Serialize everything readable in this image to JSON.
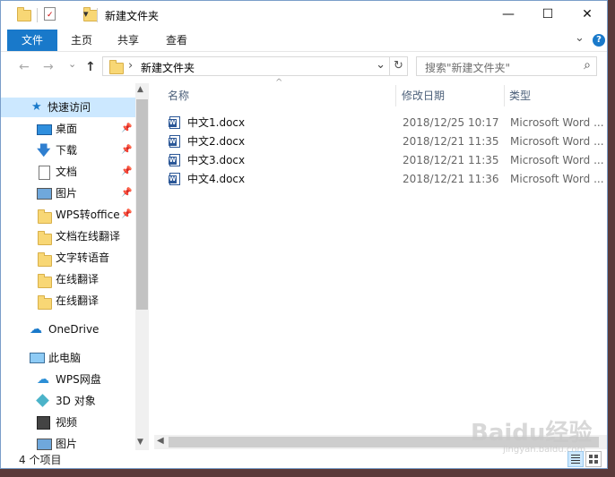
{
  "window": {
    "title": "新建文件夹",
    "controls": {
      "minimize": "—",
      "maximize": "☐",
      "close": "✕"
    }
  },
  "quick_access_toolbar": {
    "dropdown": "▾"
  },
  "ribbon": {
    "tabs": [
      {
        "label": "文件",
        "active": true
      },
      {
        "label": "主页"
      },
      {
        "label": "共享"
      },
      {
        "label": "查看"
      }
    ],
    "expand_icon": "⌄",
    "help_icon": "?"
  },
  "address_bar": {
    "path_separator": "›",
    "current_folder": "新建文件夹",
    "dropdown": "⌄",
    "refresh": "↻",
    "search_placeholder": "搜索\"新建文件夹\"",
    "search_icon": "⌕"
  },
  "nav_buttons": {
    "back": "←",
    "forward": "→",
    "recent": "⌄",
    "up": "↑"
  },
  "nav_pane": {
    "quick_access": "快速访问",
    "pinned": [
      {
        "label": "桌面",
        "icon": "desktop-icon",
        "pinned": true
      },
      {
        "label": "下载",
        "icon": "download-icon",
        "pinned": true
      },
      {
        "label": "文档",
        "icon": "document-icon",
        "pinned": true
      },
      {
        "label": "图片",
        "icon": "pictures-icon",
        "pinned": true
      },
      {
        "label": "WPS转office",
        "icon": "folder-icon",
        "pinned": true
      },
      {
        "label": "文档在线翻译",
        "icon": "folder-icon"
      },
      {
        "label": "文字转语音",
        "icon": "folder-icon"
      },
      {
        "label": "在线翻译",
        "icon": "folder-icon"
      },
      {
        "label": "在线翻译",
        "icon": "folder-icon"
      }
    ],
    "onedrive": "OneDrive",
    "this_pc": "此电脑",
    "pc_items": [
      {
        "label": "WPS网盘",
        "icon": "cloud-icon"
      },
      {
        "label": "3D 对象",
        "icon": "3d-objects-icon"
      },
      {
        "label": "视频",
        "icon": "video-icon"
      },
      {
        "label": "图片",
        "icon": "pictures-icon"
      }
    ]
  },
  "columns": {
    "name": "名称",
    "date": "修改日期",
    "type": "类型",
    "sort_indicator": "^"
  },
  "files": [
    {
      "name": "中文1.docx",
      "date": "2018/12/25 10:17",
      "type": "Microsoft Word ..."
    },
    {
      "name": "中文2.docx",
      "date": "2018/12/21 11:35",
      "type": "Microsoft Word ..."
    },
    {
      "name": "中文3.docx",
      "date": "2018/12/21 11:35",
      "type": "Microsoft Word ..."
    },
    {
      "name": "中文4.docx",
      "date": "2018/12/21 11:36",
      "type": "Microsoft Word ..."
    }
  ],
  "status": {
    "item_count": "4 个项目"
  },
  "watermark": {
    "text": "Baidu经验",
    "sub": "jingyan.baidu.com"
  },
  "colors": {
    "accent": "#1979ca",
    "selected": "#cce8ff",
    "folder": "#f8d775"
  }
}
